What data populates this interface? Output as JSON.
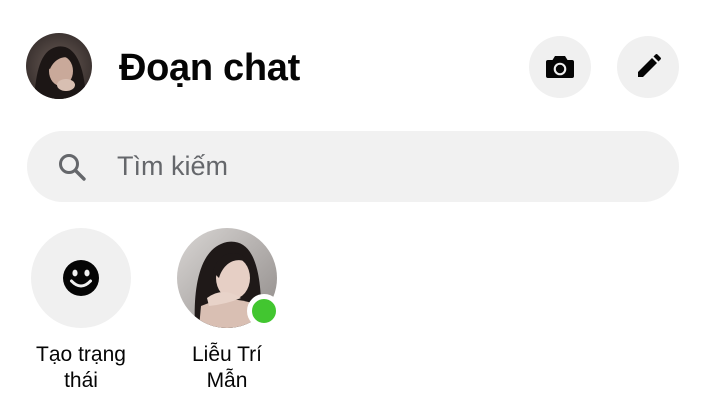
{
  "header": {
    "title": "Đoạn chat",
    "avatar_icon": "profile-photo",
    "camera_icon": "camera-icon",
    "compose_icon": "pencil-icon"
  },
  "search": {
    "placeholder": "Tìm kiếm",
    "value": "",
    "icon": "search-icon"
  },
  "stories": {
    "create": {
      "label_line1": "Tạo trạng",
      "label_line2": "thái",
      "icon": "smiley-icon"
    },
    "contacts": [
      {
        "name_line1": "Liễu Trí",
        "name_line2": "Mẫn",
        "online": true,
        "online_color": "#42c630"
      }
    ]
  },
  "colors": {
    "background": "#ffffff",
    "button_bg": "#f0f0f0",
    "search_bg": "#f1f1f1",
    "text": "#050505",
    "placeholder": "#65676b",
    "online": "#42c630"
  }
}
